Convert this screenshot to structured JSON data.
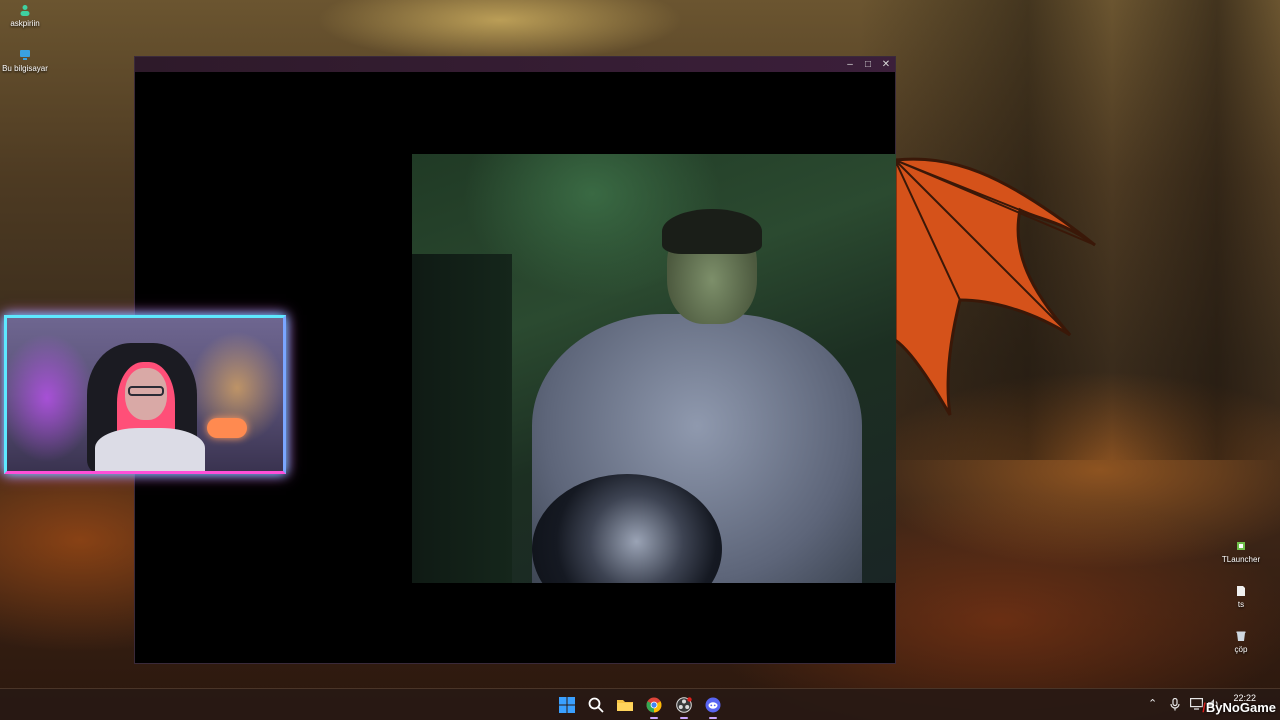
{
  "desktop": {
    "icons_left": [
      {
        "label": "askpiriin",
        "icon": "user-folder-icon"
      },
      {
        "label": "Bu bilgisayar",
        "icon": "computer-icon"
      }
    ],
    "icons_right": [
      {
        "label": "TLauncher",
        "icon": "tlauncher-icon"
      },
      {
        "label": "ts",
        "icon": "file-icon"
      },
      {
        "label": "çöp",
        "icon": "recycle-bin-icon"
      }
    ]
  },
  "window": {
    "minimize": "–",
    "maximize": "□",
    "close": "✕"
  },
  "taskbar": {
    "apps": [
      {
        "name": "start-button",
        "icon": "windows-logo-icon"
      },
      {
        "name": "search-button",
        "icon": "search-icon"
      },
      {
        "name": "file-explorer-button",
        "icon": "folder-icon"
      },
      {
        "name": "chrome-button",
        "icon": "chrome-icon"
      },
      {
        "name": "obs-button",
        "icon": "obs-icon"
      },
      {
        "name": "discord-button",
        "icon": "discord-icon"
      }
    ],
    "tray": {
      "chevron": "⌃",
      "mic": "🎙",
      "network": "🖵",
      "volume": "🔊"
    },
    "clock": {
      "time": "22:22",
      "date": ""
    }
  },
  "watermark": {
    "slash": "/",
    "text": "ByNoGame"
  },
  "colors": {
    "facecam_border_top": "#5ee8ff",
    "facecam_border_bottom": "#ff4fd8",
    "taskbar_bg": "#28190f",
    "discord": "#5865f2",
    "windows_blue": "#3aa0ff"
  }
}
